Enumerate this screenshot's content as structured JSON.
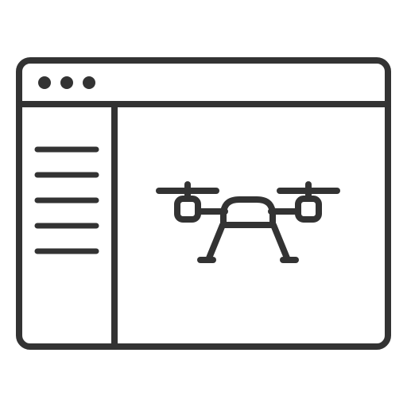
{
  "icon": {
    "name": "browser-window-drone-icon",
    "stroke_color": "#333333",
    "background_color": "#ffffff",
    "window": {
      "title_bar_dots": [
        "dot",
        "dot",
        "dot"
      ],
      "sidebar_menu_line_count": 5
    },
    "content_icon": "drone-icon"
  }
}
